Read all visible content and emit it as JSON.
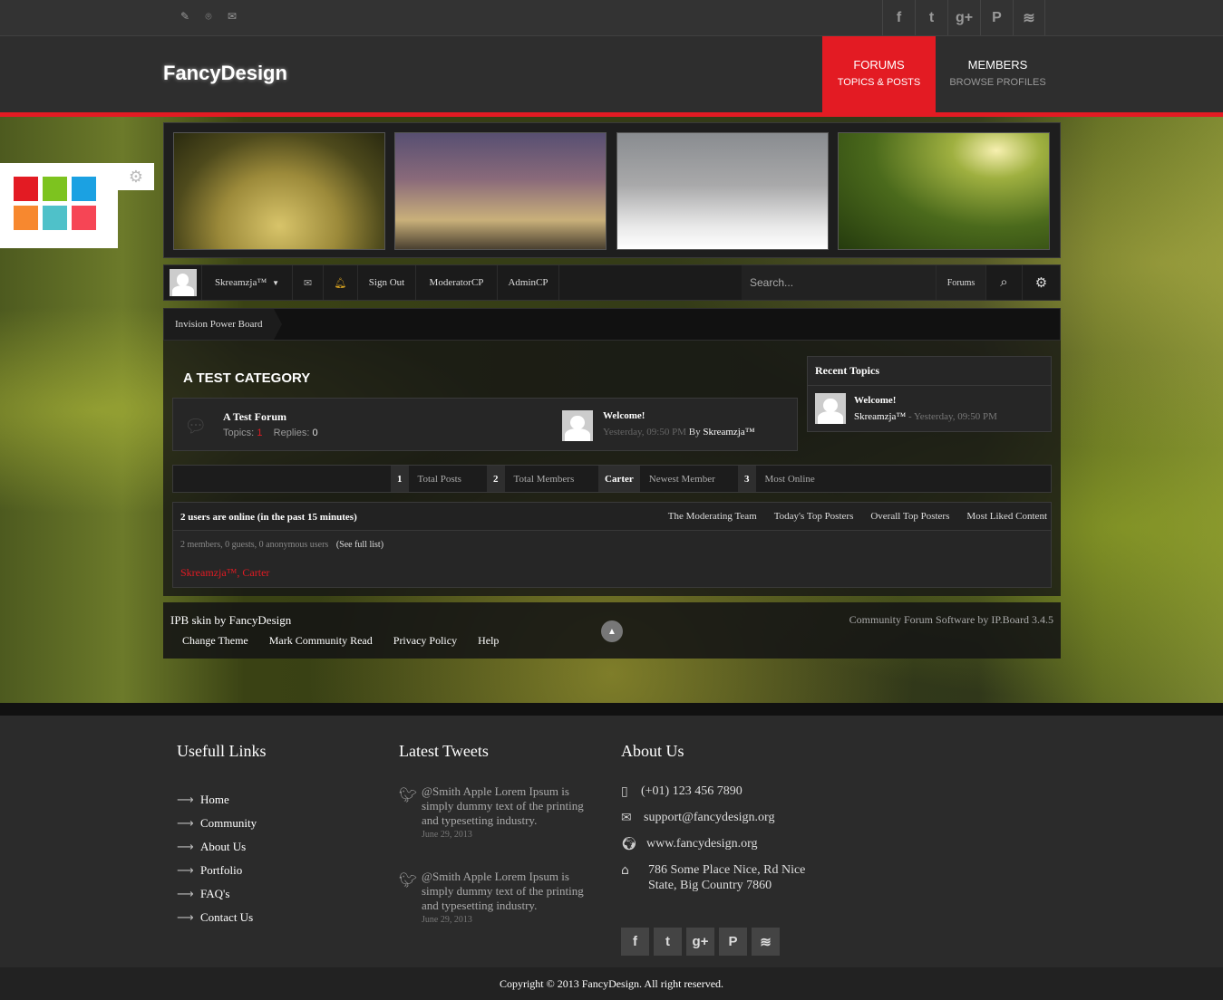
{
  "topbar": {
    "left_icons": [
      "pencil-icon",
      "map-pin-icon",
      "chat-icon"
    ],
    "social": [
      {
        "icon": "facebook-icon",
        "glyph": "f"
      },
      {
        "icon": "twitter-icon",
        "glyph": "t"
      },
      {
        "icon": "google-plus-icon",
        "glyph": "g+"
      },
      {
        "icon": "pinterest-icon",
        "glyph": "P"
      },
      {
        "icon": "rss-icon",
        "glyph": "≋"
      }
    ]
  },
  "header": {
    "logo": "FancyDesign",
    "nav": [
      {
        "title": "FORUMS",
        "subtitle": "TOPICS & POSTS",
        "active": true
      },
      {
        "title": "MEMBERS",
        "subtitle": "BROWSE PROFILES",
        "active": false
      }
    ]
  },
  "colors": {
    "accent": "#e31b23",
    "header_bg": "#2e2e2e",
    "footer_bg": "#2b2b2b"
  },
  "switcher": {
    "swatches": [
      "#e31b23",
      "#7dc31f",
      "#1ba1e2",
      "#f7882f",
      "#4fc1c9",
      "#f64555"
    ]
  },
  "gallery": [
    "meadow-tree-image",
    "grass-sunset-image",
    "snowy-forest-image",
    "mossy-forest-stream-image"
  ],
  "userbar": {
    "username": "Skreamzja™",
    "sign_out": "Sign Out",
    "moderator_cp": "ModeratorCP",
    "admin_cp": "AdminCP",
    "search_placeholder": "Search...",
    "search_scope": "Forums"
  },
  "breadcrumb": "Invision Power Board",
  "category": {
    "title": "A TEST CATEGORY",
    "forum": {
      "name": "A Test Forum",
      "topics_label": "Topics:",
      "topics": "1",
      "replies_label": "Replies:",
      "replies": "0",
      "last_post_title": "Welcome!",
      "last_post_time": "Yesterday, 09:50 PM",
      "last_post_by": "By",
      "last_post_author": "Skreamzja™"
    }
  },
  "recent_topics": {
    "title": "Recent Topics",
    "items": [
      {
        "title": "Welcome!",
        "author": "Skreamzja™",
        "time": "- Yesterday, 09:50 PM"
      }
    ]
  },
  "stats": [
    {
      "value": "1",
      "label": "Total Posts"
    },
    {
      "value": "2",
      "label": "Total Members"
    },
    {
      "value": "Carter",
      "label": "Newest Member"
    },
    {
      "value": "3",
      "label": "Most Online"
    }
  ],
  "online": {
    "title": "2 users are online (in the past 15 minutes)",
    "links": [
      "The Moderating Team",
      "Today's Top Posters",
      "Overall Top Posters",
      "Most Liked Content"
    ],
    "counts": "2 members, 0 guests, 0 anonymous users",
    "full_list": "(See full list)",
    "users": "Skreamzja™, Carter"
  },
  "forum_footer": {
    "credit": "IPB skin by FancyDesign",
    "links": [
      "Change Theme",
      "Mark Community Read",
      "Privacy Policy",
      "Help"
    ],
    "powered": "Community Forum Software by IP.Board 3.4.5"
  },
  "site_footer": {
    "useful_title": "Usefull Links",
    "useful_links": [
      "Home",
      "Community",
      "About Us",
      "Portfolio",
      "FAQ's",
      "Contact Us"
    ],
    "tweets_title": "Latest Tweets",
    "tweets": [
      {
        "text": "@Smith Apple Lorem Ipsum is simply dummy text of the printing and typesetting industry.",
        "date": "June 29, 2013"
      },
      {
        "text": "@Smith Apple Lorem Ipsum is simply dummy text of the printing and typesetting industry.",
        "date": "June 29, 2013"
      }
    ],
    "about_title": "About Us",
    "phone": "(+01) 123 456 7890",
    "email": "support@fancydesign.org",
    "website": "www.fancydesign.org",
    "address_line1": "786 Some Place Nice, Rd Nice",
    "address_line2": "State, Big Country 7860"
  },
  "copyright": "Copyright © 2013 FancyDesign. All right reserved."
}
